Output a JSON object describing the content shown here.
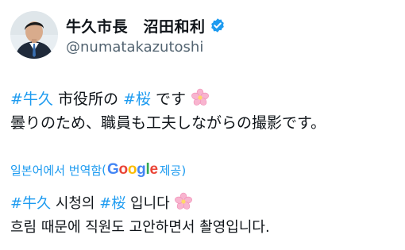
{
  "author": {
    "display_name": "牛久市長　沼田和利",
    "handle": "@numatakazutoshi",
    "verified": true
  },
  "tweet": {
    "hashtag1": "#牛久",
    "text1": " 市役所の ",
    "hashtag2": "#桜",
    "text2": " です",
    "emoji": "cherry-blossom",
    "line2": "曇りのため、職員も工夫しながらの撮影です。"
  },
  "translation": {
    "prefix": "일본어에서 번역함",
    "provider_brand": "Google",
    "suffix": " 제공)",
    "hashtag1": "#牛久",
    "text1": " 시청의 ",
    "hashtag2": "#桜",
    "text2": " 입니다 ",
    "line2": "흐림 때문에 직원도 고안하면서 촬영입니다."
  },
  "colors": {
    "link": "#1d9bf0",
    "text": "#0f1419",
    "secondary": "#536471"
  }
}
